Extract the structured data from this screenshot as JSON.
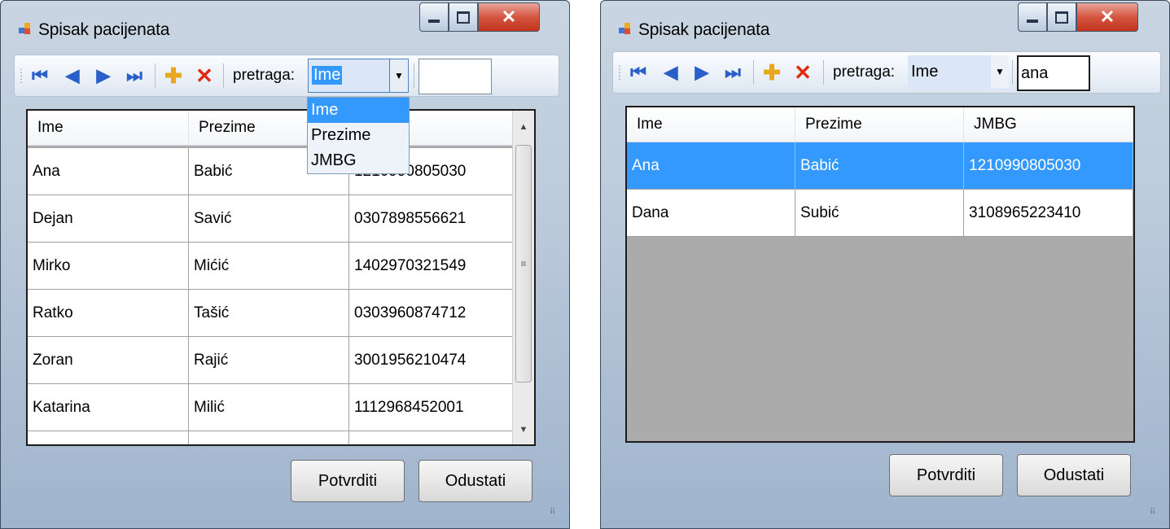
{
  "window_title": "Spisak pacijenata",
  "toolbar": {
    "search_label": "pretraga:",
    "combo_options": [
      "Ime",
      "Prezime",
      "JMBG"
    ]
  },
  "columns": [
    "Ime",
    "Prezime",
    "JMBG"
  ],
  "left_window": {
    "combo_value": "Ime",
    "search_value": "",
    "dropdown_open": true,
    "rows": [
      {
        "ime": "Ana",
        "prezime": "Babić",
        "jmbg": "1210990805030"
      },
      {
        "ime": "Dejan",
        "prezime": "Savić",
        "jmbg": "0307898556621"
      },
      {
        "ime": "Mirko",
        "prezime": "Mićić",
        "jmbg": "1402970321549"
      },
      {
        "ime": "Ratko",
        "prezime": "Tašić",
        "jmbg": "0303960874712"
      },
      {
        "ime": "Zoran",
        "prezime": "Rajić",
        "jmbg": "3001956210474"
      },
      {
        "ime": "Katarina",
        "prezime": "Milić",
        "jmbg": "1112968452001"
      }
    ]
  },
  "right_window": {
    "combo_value": "Ime",
    "search_value": "ana",
    "selected_row": 0,
    "rows": [
      {
        "ime": "Ana",
        "prezime": "Babić",
        "jmbg": "1210990805030"
      },
      {
        "ime": "Dana",
        "prezime": "Subić",
        "jmbg": "3108965223410"
      }
    ]
  },
  "buttons": {
    "confirm": "Potvrditi",
    "cancel": "Odustati"
  },
  "colors": {
    "selection": "#3399ff",
    "close_button": "#c94a35",
    "nav_icons": "#2a5fc9"
  }
}
